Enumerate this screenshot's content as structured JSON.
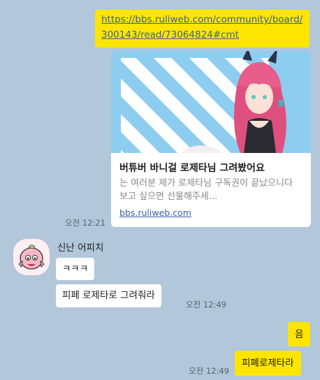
{
  "outgoing_link": {
    "url_text": "https://bbs.ruliweb.com/community/board/300143/read/73064824#cmt"
  },
  "link_preview": {
    "title": "버튜버 바니걸 로제타님 그려봤어요",
    "description": "는 여러분 제가 로제타님 구독권이 끝났으니다 보고 싶으면 선물해주세...",
    "domain": "bbs.ruliweb.com"
  },
  "time_1": "오전 12:21",
  "incoming": {
    "sender_name": "신난 어피치",
    "messages": [
      "ㅋㅋㅋ",
      "피페 로제타로 그려줘라"
    ],
    "time": "오전 12:49"
  },
  "outgoing_2": {
    "messages": [
      "음",
      "피폐로제타라"
    ],
    "time": "오전 12:49"
  },
  "colors": {
    "background": "#b2c7d9",
    "my_bubble": "#fee500",
    "their_bubble": "#ffffff"
  }
}
